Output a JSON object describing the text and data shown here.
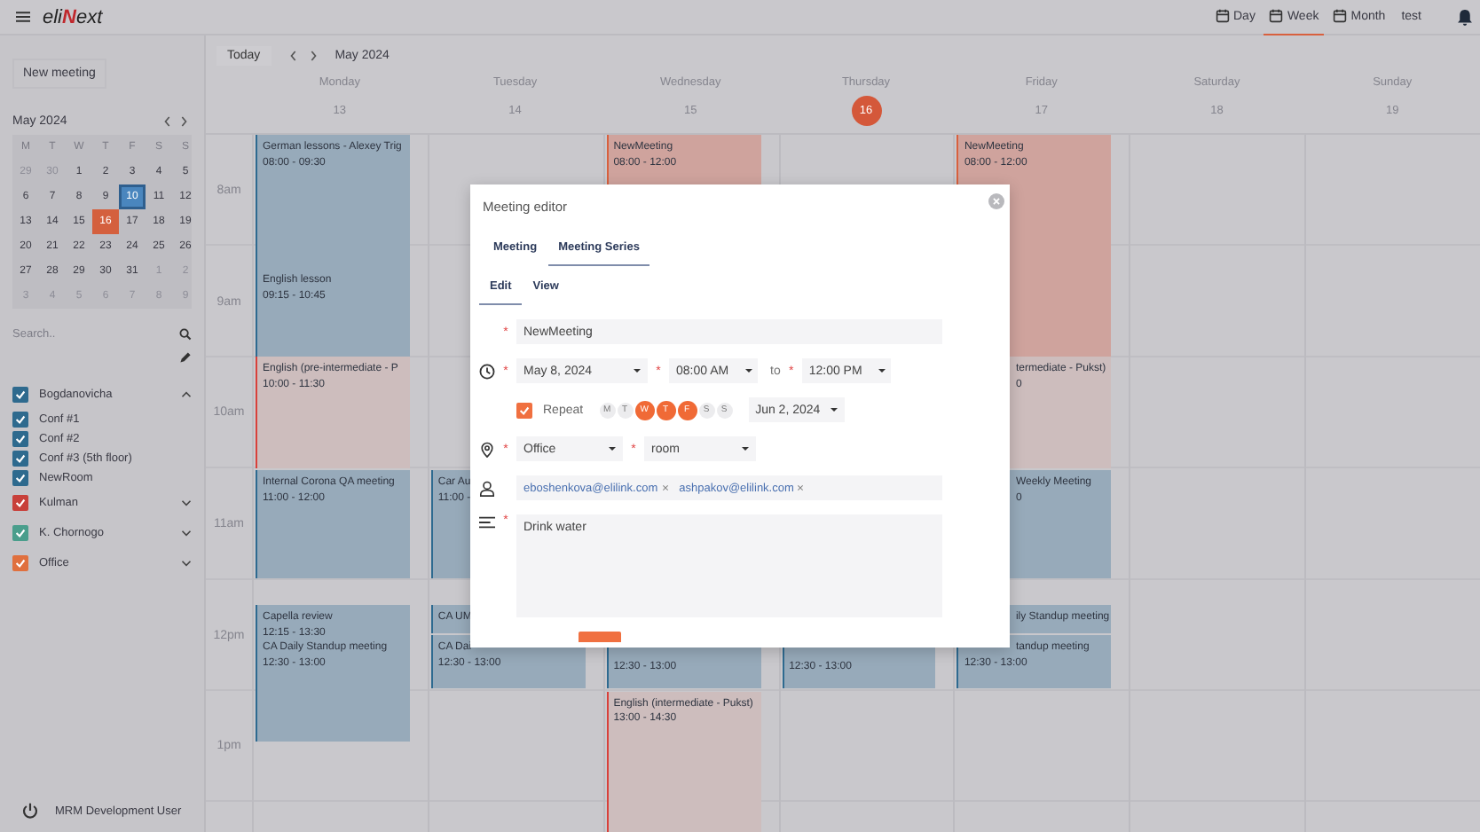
{
  "required_mark": "*",
  "top_bar": {
    "logo": [
      {
        "text": "eli",
        "accent": false
      },
      {
        "text": "N",
        "accent": true
      },
      {
        "text": "ext",
        "accent": false
      }
    ],
    "views": [
      {
        "label": "Day",
        "selected": false
      },
      {
        "label": "Week",
        "selected": true
      },
      {
        "label": "Month",
        "selected": false
      }
    ],
    "user": "test"
  },
  "sidebar": {
    "new_meeting": "New meeting",
    "mini_calendar": {
      "title": "May 2024",
      "weekdays": [
        "M",
        "T",
        "W",
        "T",
        "F",
        "S",
        "S"
      ],
      "weeks": [
        [
          {
            "d": "29",
            "in_month": false,
            "selected": false,
            "today": false
          },
          {
            "d": "30",
            "in_month": false,
            "selected": false,
            "today": false
          },
          {
            "d": "1",
            "in_month": true,
            "selected": false,
            "today": false
          },
          {
            "d": "2",
            "in_month": true,
            "selected": false,
            "today": false
          },
          {
            "d": "3",
            "in_month": true,
            "selected": false,
            "today": false
          },
          {
            "d": "4",
            "in_month": true,
            "selected": false,
            "today": false
          },
          {
            "d": "5",
            "in_month": true,
            "selected": false,
            "today": false
          }
        ],
        [
          {
            "d": "6",
            "in_month": true,
            "selected": false,
            "today": false
          },
          {
            "d": "7",
            "in_month": true,
            "selected": false,
            "today": false
          },
          {
            "d": "8",
            "in_month": true,
            "selected": false,
            "today": false
          },
          {
            "d": "9",
            "in_month": true,
            "selected": false,
            "today": false
          },
          {
            "d": "10",
            "in_month": true,
            "selected": true,
            "today": false
          },
          {
            "d": "11",
            "in_month": true,
            "selected": false,
            "today": false
          },
          {
            "d": "12",
            "in_month": true,
            "selected": false,
            "today": false
          }
        ],
        [
          {
            "d": "13",
            "in_month": true,
            "selected": false,
            "today": false
          },
          {
            "d": "14",
            "in_month": true,
            "selected": false,
            "today": false
          },
          {
            "d": "15",
            "in_month": true,
            "selected": false,
            "today": false
          },
          {
            "d": "16",
            "in_month": true,
            "selected": false,
            "today": true
          },
          {
            "d": "17",
            "in_month": true,
            "selected": false,
            "today": false
          },
          {
            "d": "18",
            "in_month": true,
            "selected": false,
            "today": false
          },
          {
            "d": "19",
            "in_month": true,
            "selected": false,
            "today": false
          }
        ],
        [
          {
            "d": "20",
            "in_month": true,
            "selected": false,
            "today": false
          },
          {
            "d": "21",
            "in_month": true,
            "selected": false,
            "today": false
          },
          {
            "d": "22",
            "in_month": true,
            "selected": false,
            "today": false
          },
          {
            "d": "23",
            "in_month": true,
            "selected": false,
            "today": false
          },
          {
            "d": "24",
            "in_month": true,
            "selected": false,
            "today": false
          },
          {
            "d": "25",
            "in_month": true,
            "selected": false,
            "today": false
          },
          {
            "d": "26",
            "in_month": true,
            "selected": false,
            "today": false
          }
        ],
        [
          {
            "d": "27",
            "in_month": true,
            "selected": false,
            "today": false
          },
          {
            "d": "28",
            "in_month": true,
            "selected": false,
            "today": false
          },
          {
            "d": "29",
            "in_month": true,
            "selected": false,
            "today": false
          },
          {
            "d": "30",
            "in_month": true,
            "selected": false,
            "today": false
          },
          {
            "d": "31",
            "in_month": true,
            "selected": false,
            "today": false
          },
          {
            "d": "1",
            "in_month": false,
            "selected": false,
            "today": false
          },
          {
            "d": "2",
            "in_month": false,
            "selected": false,
            "today": false
          }
        ],
        [
          {
            "d": "3",
            "in_month": false,
            "selected": false,
            "today": false
          },
          {
            "d": "4",
            "in_month": false,
            "selected": false,
            "today": false
          },
          {
            "d": "5",
            "in_month": false,
            "selected": false,
            "today": false
          },
          {
            "d": "6",
            "in_month": false,
            "selected": false,
            "today": false
          },
          {
            "d": "7",
            "in_month": false,
            "selected": false,
            "today": false
          },
          {
            "d": "8",
            "in_month": false,
            "selected": false,
            "today": false
          },
          {
            "d": "9",
            "in_month": false,
            "selected": false,
            "today": false
          }
        ]
      ]
    },
    "search": {
      "placeholder": "Search.."
    },
    "calendars": [
      {
        "name": "Bogdanovicha",
        "checked": true,
        "color": "#2e6a8e",
        "expanded": true,
        "children": [
          {
            "name": "Conf #1",
            "checked": true
          },
          {
            "name": "Conf #2",
            "checked": true
          },
          {
            "name": "Conf #3 (5th floor)",
            "checked": true
          },
          {
            "name": "NewRoom",
            "checked": true
          }
        ]
      },
      {
        "name": "Kulman",
        "checked": true,
        "color": "#c8403a",
        "expanded": false
      },
      {
        "name": "K. Chornogo",
        "checked": true,
        "color": "#4a9e8c",
        "expanded": false
      },
      {
        "name": "Office",
        "checked": true,
        "color": "#e0703e",
        "expanded": false
      }
    ],
    "user": "MRM Development User"
  },
  "toolbar": {
    "today": "Today",
    "period": "May 2024"
  },
  "hours": [
    "8am",
    "9am",
    "10am",
    "11am",
    "12pm",
    "1pm"
  ],
  "days": [
    {
      "name": "Monday",
      "date": "13",
      "selected": false,
      "events": [
        {
          "title": "German lessons - Alexey Trig",
          "time": "08:00 - 09:30",
          "kind": "booked"
        },
        {
          "title": "English lesson",
          "time": "09:15 - 10:45",
          "kind": "booked"
        },
        {
          "title": "English (pre-intermediate - P",
          "time": "10:00 - 11:30",
          "kind": "tentative"
        },
        {
          "title": "Internal Corona QA meeting",
          "time": "11:00 - 12:00",
          "kind": "booked"
        },
        {
          "title": "Capella review",
          "time": "12:15 - 13:30",
          "kind": "booked"
        },
        {
          "title": "CA Daily Standup meeting",
          "time": "12:30 - 13:00",
          "kind": "booked"
        }
      ]
    },
    {
      "name": "Tuesday",
      "date": "14",
      "selected": false,
      "events": [
        {
          "title": "Car Au",
          "time": "11:00 -",
          "kind": "booked"
        },
        {
          "title": "CA UM",
          "kind": "booked"
        },
        {
          "title": "CA Dai",
          "time": "12:30 - 13:00",
          "kind": "booked"
        }
      ]
    },
    {
      "name": "Wednesday",
      "date": "15",
      "selected": false,
      "events": [
        {
          "title": "NewMeeting",
          "time": "08:00 - 12:00",
          "kind": "mine"
        },
        {
          "time": "12:30 - 13:00",
          "kind": "booked"
        },
        {
          "title": "English (intermediate - Pukst)",
          "time": "13:00 - 14:30",
          "kind": "tentative"
        }
      ]
    },
    {
      "name": "Thursday",
      "date": "16",
      "selected": true,
      "events": [
        {
          "time": "12:30 - 13:00",
          "kind": "booked"
        }
      ]
    },
    {
      "name": "Friday",
      "date": "17",
      "selected": false,
      "events": [
        {
          "title": "NewMeeting",
          "time": "08:00 - 12:00",
          "kind": "mine"
        },
        {
          "title": "termediate - Pukst)",
          "time": "0",
          "kind": "tentative"
        },
        {
          "title": "Weekly Meeting",
          "time": "0",
          "kind": "booked"
        },
        {
          "title": "ily Standup meeting",
          "kind": "booked"
        },
        {
          "title": "tandup meeting",
          "time": "12:30 - 13:00",
          "kind": "booked"
        }
      ]
    },
    {
      "name": "Saturday",
      "date": "18",
      "selected": false
    },
    {
      "name": "Sunday",
      "date": "19",
      "selected": false
    }
  ],
  "modal": {
    "title": "Meeting editor",
    "tabs": [
      {
        "label": "Meeting",
        "selected": false
      },
      {
        "label": "Meeting Series",
        "selected": true
      }
    ],
    "subtabs": [
      {
        "label": "Edit",
        "selected": true
      },
      {
        "label": "View",
        "selected": false
      }
    ],
    "name": {
      "value": "NewMeeting",
      "required": true
    },
    "date": {
      "value": "May 8, 2024",
      "required": true
    },
    "start": {
      "value": "08:00 AM",
      "required": true
    },
    "to": "to",
    "end": {
      "value": "12:00 PM",
      "required": true
    },
    "repeat": {
      "label": "Repeat",
      "checked": true,
      "days": [
        {
          "label": "M",
          "selected": false
        },
        {
          "label": "T",
          "selected": false
        },
        {
          "label": "W",
          "selected": true
        },
        {
          "label": "T",
          "selected": true
        },
        {
          "label": "F",
          "selected": true
        },
        {
          "label": "S",
          "selected": false
        },
        {
          "label": "S",
          "selected": false
        }
      ],
      "until": "Jun 2, 2024"
    },
    "location": {
      "value": "Office",
      "required": true
    },
    "room": {
      "value": "room",
      "required": true
    },
    "attendees": [
      "eboshenkova@elilink.com",
      "ashpakov@elilink.com"
    ],
    "description": {
      "value": "Drink water",
      "required": true
    }
  }
}
